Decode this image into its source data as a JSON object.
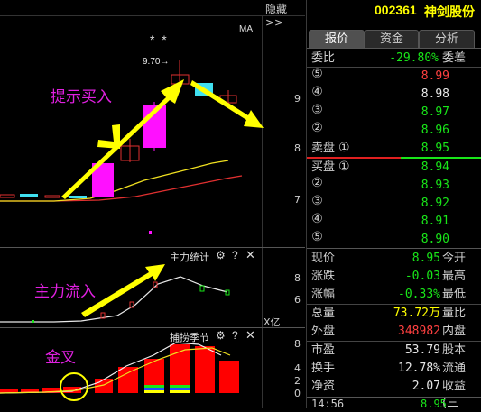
{
  "header": {
    "hide_label": "隐藏>>",
    "stock_code": "002361",
    "stock_name": "神剑股份"
  },
  "tabs": [
    {
      "label": "报价",
      "active": true
    },
    {
      "label": "资金",
      "active": false
    },
    {
      "label": "分析",
      "active": false
    }
  ],
  "main_chart": {
    "indicator": "MA",
    "stars": "*  *",
    "high_marker": "9.70→",
    "price_ticks": [
      "9",
      "8",
      "7"
    ],
    "annotation": "提示买入"
  },
  "flow_panel": {
    "title": "主力统计",
    "annotation": "主力流入",
    "ticks": [
      "8",
      "6"
    ],
    "unit": "X亿"
  },
  "season_panel": {
    "title": "捕捞季节",
    "annotation": "金叉",
    "ticks": [
      "8",
      "4",
      "2",
      "0"
    ]
  },
  "order_book": {
    "ratio_label": "委比",
    "ratio_value": "-29.80%",
    "diff_label": "委差",
    "sell_label": "卖盘",
    "buy_label": "买盘",
    "sells": [
      {
        "level": "⑤",
        "price": "8.99",
        "color": "#ff4040"
      },
      {
        "level": "④",
        "price": "8.98",
        "color": "#e8e8e8"
      },
      {
        "level": "③",
        "price": "8.97",
        "color": "#19e619"
      },
      {
        "level": "②",
        "price": "8.96",
        "color": "#19e619"
      },
      {
        "level": "①",
        "price": "8.95",
        "color": "#19e619"
      }
    ],
    "buys": [
      {
        "level": "①",
        "price": "8.94",
        "color": "#19e619"
      },
      {
        "level": "②",
        "price": "8.93",
        "color": "#19e619"
      },
      {
        "level": "③",
        "price": "8.92",
        "color": "#19e619"
      },
      {
        "level": "④",
        "price": "8.91",
        "color": "#19e619"
      },
      {
        "level": "⑤",
        "price": "8.90",
        "color": "#19e619"
      }
    ]
  },
  "stats": [
    {
      "l1": "现价",
      "v1": "8.95",
      "c1": "#19e619",
      "l2": "今开"
    },
    {
      "l1": "涨跌",
      "v1": "-0.03",
      "c1": "#19e619",
      "l2": "最高"
    },
    {
      "l1": "涨幅",
      "v1": "-0.33%",
      "c1": "#19e619",
      "l2": "最低"
    },
    {
      "l1": "总量",
      "v1": "73.72万",
      "c1": "#ffff00",
      "l2": "量比"
    },
    {
      "l1": "外盘",
      "v1": "348982",
      "c1": "#ff4040",
      "l2": "内盘"
    },
    {
      "l1": "市盈",
      "v1": "53.79",
      "c1": "#e8e8e8",
      "l2": "股本"
    },
    {
      "l1": "换手",
      "v1": "12.78%",
      "c1": "#e8e8e8",
      "l2": "流通"
    },
    {
      "l1": "净资",
      "v1": "2.07",
      "c1": "#e8e8e8",
      "l2": "收益(三"
    }
  ],
  "tick": {
    "time": "14:56",
    "price": "8.95"
  }
}
